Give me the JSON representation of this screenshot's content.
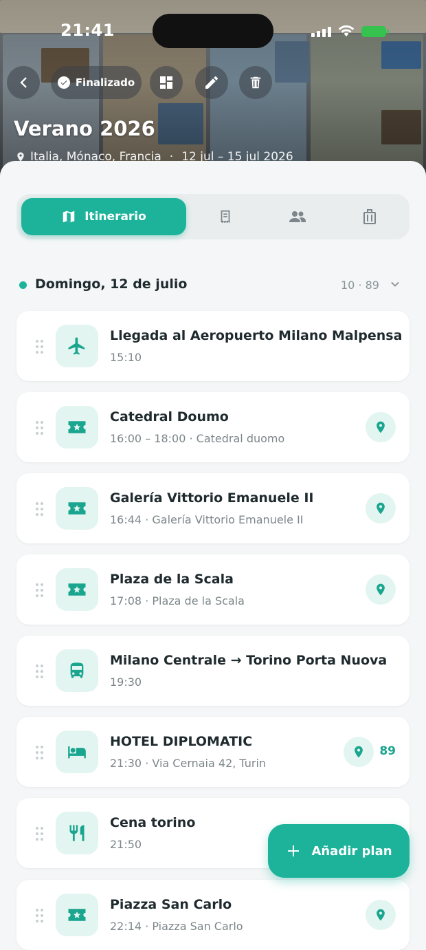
{
  "status_bar": {
    "time": "21:41"
  },
  "header": {
    "status_label": "Finalizado",
    "title": "Verano 2026",
    "countries": "Italia, Mónaco, Francia",
    "dates": "12 jul – 15 jul 2026",
    "icons": [
      "back-icon",
      "check-icon",
      "layout-icon",
      "edit-icon",
      "delete-icon",
      "location-pin-icon"
    ]
  },
  "tabs": [
    {
      "label": "Itinerario",
      "icon": "map-icon",
      "active": true
    },
    {
      "label": "",
      "icon": "receipt-icon",
      "active": false
    },
    {
      "label": "",
      "icon": "people-icon",
      "active": false
    },
    {
      "label": "",
      "icon": "luggage-icon",
      "active": false
    }
  ],
  "day": {
    "title": "Domingo, 12 de julio",
    "stats": "10 · 89"
  },
  "items": [
    {
      "title": "Llegada al Aeropuerto Milano Malpensa",
      "subtitle": "15:10",
      "icon": "airplane-icon",
      "has_pin": false
    },
    {
      "title": "Catedral Doumo",
      "subtitle": "16:00 – 18:00 · Catedral duomo",
      "icon": "ticket-icon",
      "has_pin": true
    },
    {
      "title": "Galería Vittorio Emanuele II",
      "subtitle": "16:44 · Galería Vittorio Emanuele II",
      "icon": "ticket-icon",
      "has_pin": true
    },
    {
      "title": "Plaza de la Scala",
      "subtitle": "17:08 · Plaza de la Scala",
      "icon": "ticket-icon",
      "has_pin": true
    },
    {
      "title": "Milano Centrale → Torino Porta Nuova",
      "subtitle": "19:30",
      "icon": "bus-icon",
      "has_pin": false
    },
    {
      "title": "HOTEL DIPLOMATIC",
      "subtitle": "21:30 · Via Cernaia 42, Turin",
      "icon": "bed-icon",
      "has_pin": true,
      "count": "89"
    },
    {
      "title": "Cena torino",
      "subtitle": "21:50",
      "icon": "restaurant-icon",
      "has_pin": false
    },
    {
      "title": "Piazza San Carlo",
      "subtitle": "22:14 · Piazza San Carlo",
      "icon": "ticket-icon",
      "has_pin": true
    }
  ],
  "fab": {
    "label": "Añadir plan",
    "icon": "plus-icon"
  },
  "colors": {
    "accent": "#1db39b",
    "accent_soft": "#e3f5f1",
    "background": "#f4f6f7"
  }
}
